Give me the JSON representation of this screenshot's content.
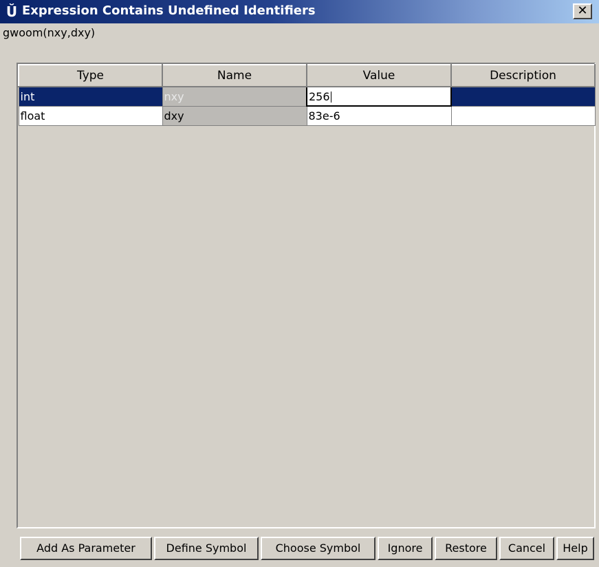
{
  "window": {
    "title": "Expression Contains Undefined Identifiers",
    "close_label": "✕"
  },
  "expression": "gwoom(nxy,dxy)",
  "table": {
    "columns": [
      "Type",
      "Name",
      "Value",
      "Description"
    ],
    "rows": [
      {
        "type": "int",
        "name": "nxy",
        "value": "256",
        "description": ""
      },
      {
        "type": "float",
        "name": "dxy",
        "value": "83e-6",
        "description": ""
      }
    ]
  },
  "buttons": {
    "add_as_parameter": "Add As Parameter",
    "define_symbol": "Define Symbol",
    "choose_symbol": "Choose Symbol",
    "ignore": "Ignore",
    "restore": "Restore",
    "cancel": "Cancel",
    "help": "Help"
  },
  "colors": {
    "title_bar": "#0a246a",
    "selection": "#0a246a",
    "dialog_bg": "#d4d0c8"
  }
}
